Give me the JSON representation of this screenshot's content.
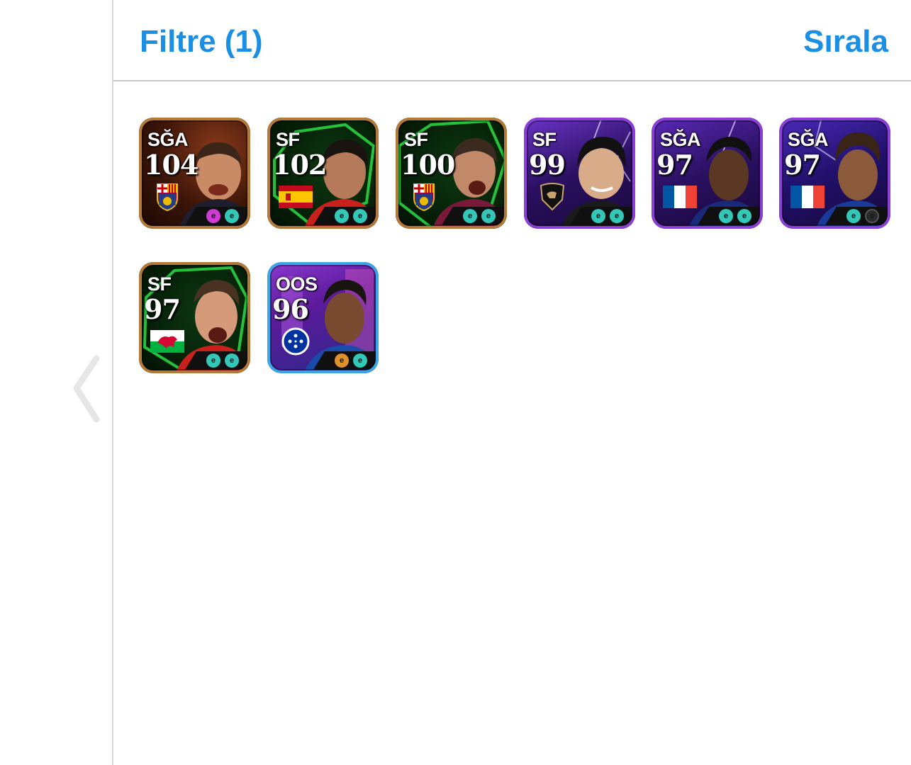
{
  "header": {
    "filter_label": "Filtre (1)",
    "sort_label": "Sırala"
  },
  "nav": {
    "back_icon": "chevron-left-icon"
  },
  "colors": {
    "accent": "#1a8fe3",
    "rim_gold": "#b57a3a",
    "rim_purple": "#8b3fd6",
    "rim_blue": "#3aa6e8"
  },
  "players": [
    {
      "position": "SĞA",
      "rating": "104",
      "badge": "fc-barcelona-crest-icon",
      "skills": [
        "pink",
        "teal"
      ]
    },
    {
      "position": "SF",
      "rating": "102",
      "badge": "spain-flag-icon",
      "skills": [
        "teal",
        "teal"
      ]
    },
    {
      "position": "SF",
      "rating": "100",
      "badge": "fc-barcelona-crest-icon",
      "skills": [
        "teal",
        "teal"
      ]
    },
    {
      "position": "SF",
      "rating": "99",
      "badge": "lafc-crest-icon",
      "skills": [
        "teal",
        "teal"
      ]
    },
    {
      "position": "SĞA",
      "rating": "97",
      "badge": "france-flag-icon",
      "skills": [
        "teal",
        "teal"
      ]
    },
    {
      "position": "SĞA",
      "rating": "97",
      "badge": "france-flag-icon",
      "skills": [
        "teal",
        "dark"
      ]
    },
    {
      "position": "SF",
      "rating": "97",
      "badge": "wales-flag-icon",
      "skills": [
        "teal",
        "teal"
      ]
    },
    {
      "position": "OOS",
      "rating": "96",
      "badge": "cruzeiro-crest-icon",
      "skills": [
        "orange",
        "teal"
      ]
    }
  ]
}
